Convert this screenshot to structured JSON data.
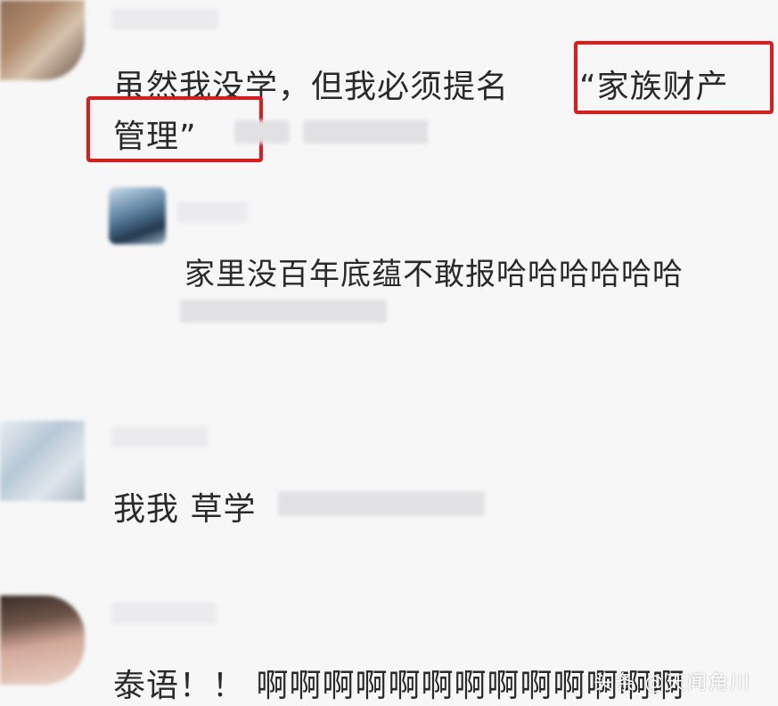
{
  "comments": [
    {
      "text_line1_a": "虽然我没学，但我必须提名",
      "text_line1_b": "“家族财产",
      "text_line2_a": "管理”",
      "reply": {
        "text": "家里没百年底蕴不敢报哈哈哈哈哈哈"
      }
    },
    {
      "text": "我我 草学"
    },
    {
      "text": "泰语！！ 啊啊啊啊啊啊啊啊啊啊啊啊啊"
    }
  ],
  "watermark": "头条 @天闻角川"
}
